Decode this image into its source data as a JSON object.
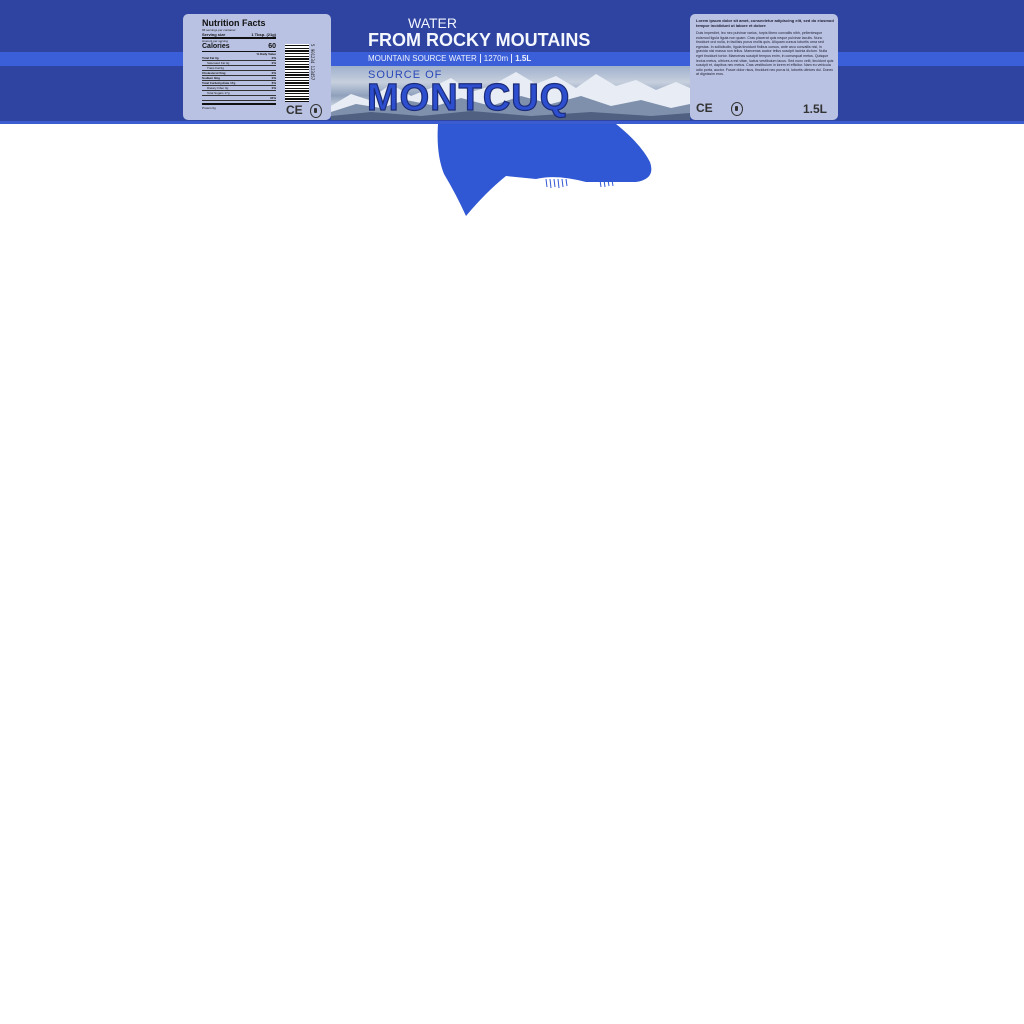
{
  "nutrition": {
    "title": "Nutrition Facts",
    "servings": "96 servings per container",
    "serving_label": "Serving size",
    "serving_value": "1 Tbsp. (21g)",
    "amount_label": "Amount per serving",
    "calories_label": "Calories",
    "calories_value": "60",
    "dv_header": "% Daily Value",
    "rows": [
      {
        "label": "Total Fat 0g",
        "dv": "0%",
        "indent": false
      },
      {
        "label": "Saturated Fat 0g",
        "dv": "0%",
        "indent": true
      },
      {
        "label": "Trans Fat 0g",
        "dv": "",
        "indent": true
      },
      {
        "label": "Cholesterol 0mg",
        "dv": "0%",
        "indent": false
      },
      {
        "label": "Sodium 0mg",
        "dv": "0%",
        "indent": false
      },
      {
        "label": "Total Carbohydrate 17g",
        "dv": "6%",
        "indent": false
      },
      {
        "label": "Dietary Fiber 0g",
        "dv": "0%",
        "indent": true
      },
      {
        "label": "Total Sugars 17g",
        "dv": "",
        "indent": true
      },
      {
        "label": "",
        "dv": "34%",
        "indent": true
      }
    ],
    "protein": "Protein 0g"
  },
  "barcode_number": "5 901234 123457",
  "marks": {
    "ce": "CE"
  },
  "header": {
    "water": "WATER",
    "main": "FROM ROCKY MOUTAINS",
    "sub": [
      "MOUNTAIN SOURCE WATER",
      "1270m",
      "1.5L"
    ]
  },
  "brand": {
    "source": "SOURCE OF",
    "name": "MONTCUQ"
  },
  "info": {
    "heading": "Lorem ipsum dolor sit amet, consectetur adipiscing elit, sed do eiusmod tempor incididunt ut labore et dolore",
    "body": "Duis imperdiet, leo nec pulvinar varius, turpis libero convallis nibh, pellentesque euismod ligula ligula non quam. Cras placerat quis neque pulvinar iaculis. Nunc tincidunt orci nulla, in facilisis purus mollis quis. Aliquam cursus lobortis urna sed egestas. In sollicitudin, ligula tincidunt finibus cursus, ante arcu convallis nisl, in gravida nisi massa non tellus. Maecenas auctor tellus suscipit lacinia dictum. Nulla eget tincidunt tortor. Maecenas suscipit tempus enim, in consequat metus. Quisque lectus metus, ultrices a est vitae, luctus vestibulum lacus. Sed nunc velit, tincidunt quis suscipit et, dapibus nec metus. Cras vestibulum in lorem et efficitur. Nam eu vehicula odio porta, auctor. Fusce dolor risus, tincidunt nec purus id, lobortis ultrices dui. Donec at dignissim eros.",
    "volume": "1.5L"
  },
  "colors": {
    "band": "#2e44a0",
    "stripe": "#3a5fd8",
    "panel": "#b9c2e2",
    "brand": "#2d4fcf",
    "blob": "#3158d4"
  }
}
